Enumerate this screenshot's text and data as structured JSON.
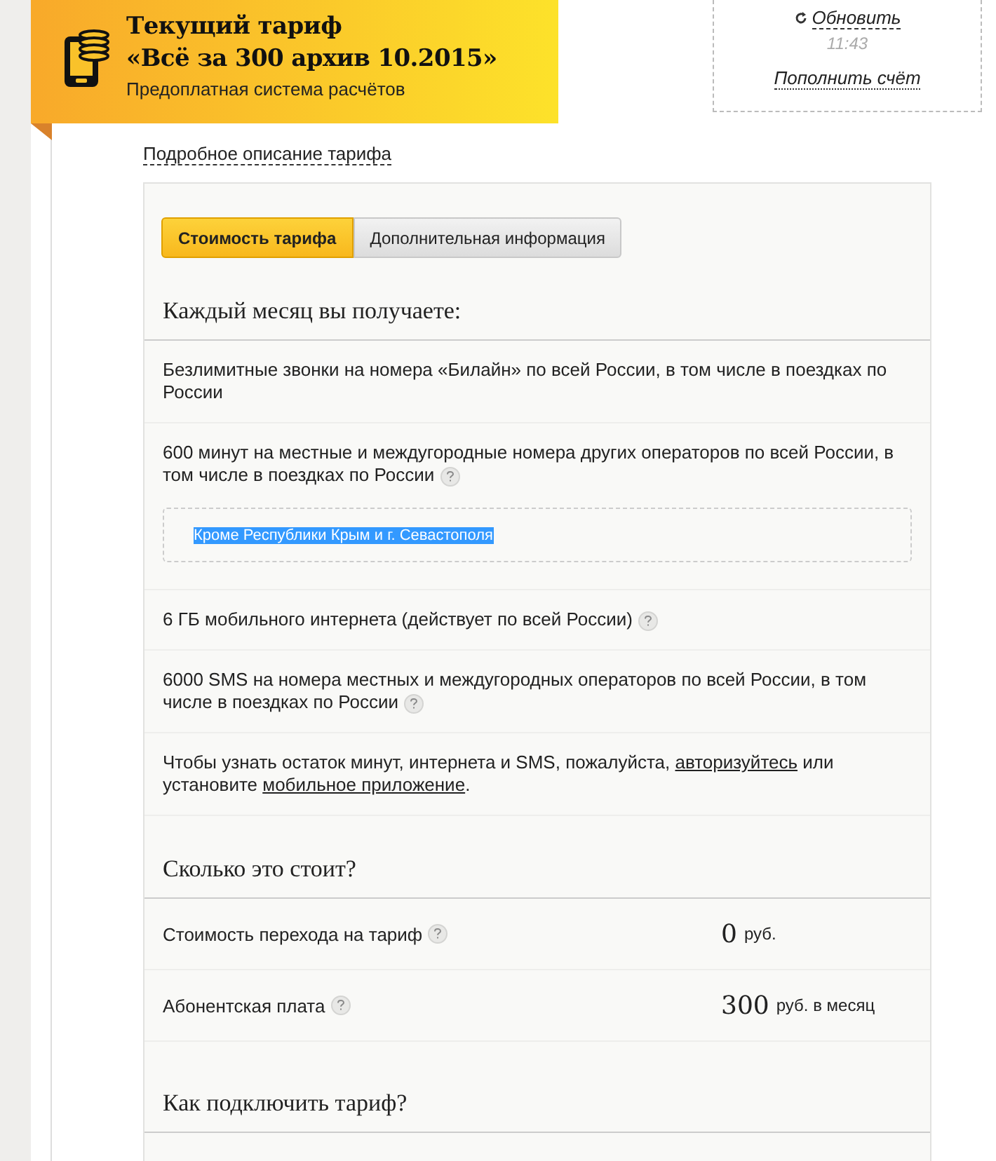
{
  "banner": {
    "title_line_1": "Текущий тариф",
    "title_line_2": "«Всё за 300 архив 10.2015»",
    "subtitle": "Предоплатная система расчётов"
  },
  "balance_box": {
    "refresh_link": "Обновить",
    "time": "11:43",
    "top_up_link": "Пополнить счёт"
  },
  "details_link": "Подробное описание тарифа",
  "tabs": [
    {
      "label": "Стоимость тарифа",
      "selected": true
    },
    {
      "label": "Дополнительная информация",
      "selected": false
    }
  ],
  "monthly": {
    "heading": "Каждый месяц вы получаете:",
    "items": [
      {
        "kind": "text",
        "text": "Безлимитные звонки на номера «Билайн» по всей России, в том числе в поездках по России",
        "help": false
      },
      {
        "kind": "text",
        "text": "600 минут на местные и междугородные номера других операторов по всей России, в том числе в поездках по России",
        "help": true,
        "note": {
          "text": "Кроме Республики Крым и г. Севастополя",
          "highlighted": true
        }
      },
      {
        "kind": "text",
        "text": "6 ГБ мобильного интернета (действует по всей России)",
        "help": true
      },
      {
        "kind": "text",
        "text": "6000 SMS на номера местных и междугородных операторов по всей России, в том числе в поездках по России",
        "help": true
      },
      {
        "kind": "links",
        "parts": [
          {
            "text": "Чтобы узнать остаток минут, интернета и SMS, пожалуйста, ",
            "link": false
          },
          {
            "text": "авторизуйтесь",
            "link": true
          },
          {
            "text": " или установите ",
            "link": false
          },
          {
            "text": "мобильное приложение",
            "link": true
          },
          {
            "text": ".",
            "link": false
          }
        ]
      }
    ]
  },
  "cost": {
    "heading": "Сколько это стоит?",
    "rows": [
      {
        "label": "Стоимость перехода на тариф",
        "help": true,
        "amount": "0",
        "unit": "руб."
      },
      {
        "label": "Абонентская плата",
        "help": true,
        "amount": "300",
        "unit": "руб. в месяц"
      }
    ]
  },
  "connect": {
    "heading": "Как подключить тариф?"
  }
}
